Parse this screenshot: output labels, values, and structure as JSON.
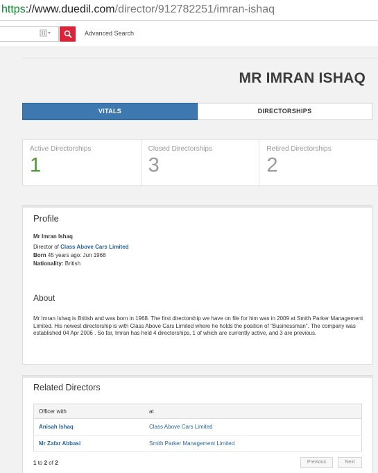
{
  "browser": {
    "url_scheme": "https",
    "url_host": "://www.duedil.com",
    "url_path": "/director/912782251/imran-ishaq"
  },
  "search": {
    "advanced_label": "Advanced Search"
  },
  "page": {
    "title": "MR IMRAN ISHAQ"
  },
  "tabs": [
    {
      "label": "VITALS",
      "active": true
    },
    {
      "label": "DIRECTORSHIPS",
      "active": false
    }
  ],
  "stats": [
    {
      "label": "Active Directorships",
      "value": "1"
    },
    {
      "label": "Closed Directorships",
      "value": "3"
    },
    {
      "label": "Retired Directorships",
      "value": "2"
    }
  ],
  "profile": {
    "heading": "Profile",
    "name": "Mr Imran Ishaq",
    "director_of_prefix": "Director of",
    "director_of_company": "Class Above Cars Limited",
    "born_label": "Born",
    "born_value": "45 years ago: Jun 1968",
    "nationality_label": "Nationality:",
    "nationality_value": "British",
    "about_heading": "About",
    "about_text": "Mr Imran Ishaq is British and was born in 1968. The first directorship we have on file for him was in 2009 at Smith Parker Management Limited. His newest directorship is with Class Above Cars Limited where he holds the position of \"Businessman\". The company was established 04 Apr 2006 . So far, Imran has held 4 directorships, 1 of which are currently active, and 3 are previous."
  },
  "related": {
    "heading": "Related Directors",
    "columns": [
      "Officer with",
      "at"
    ],
    "rows": [
      {
        "director": "Anisah Ishaq",
        "company": "Class Above Cars Limited"
      },
      {
        "director": "Mr Zafar Abbasi",
        "company": "Smith Parker Management Limited"
      }
    ],
    "pager": {
      "start": "1",
      "to": "to",
      "end": "2",
      "of": "of",
      "total": "2"
    },
    "prev_label": "Previous",
    "next_label": "Next"
  },
  "colors": {
    "accent_tab": "#3d79ae",
    "search_button": "#d9243a",
    "active_count": "#4d9a2f",
    "link": "#2a6496"
  }
}
